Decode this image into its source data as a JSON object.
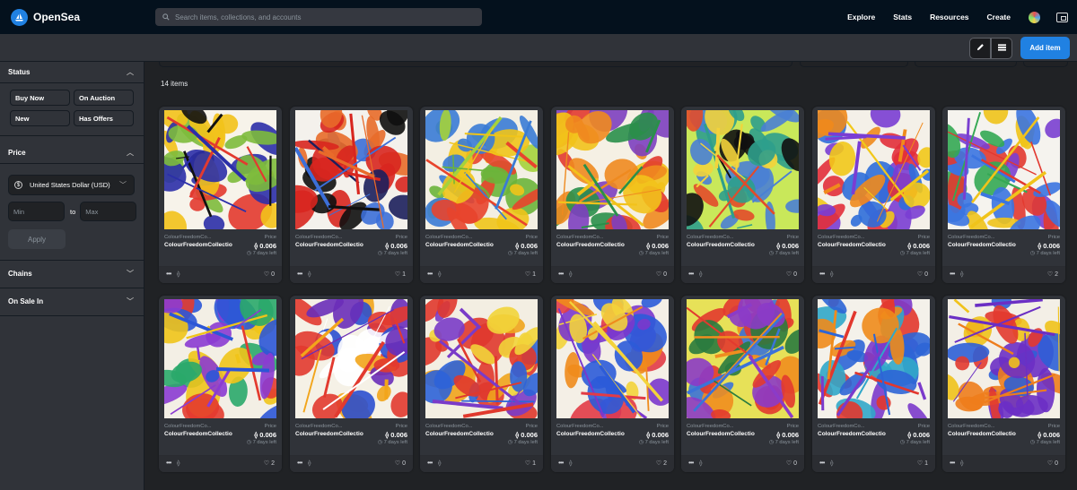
{
  "header": {
    "brand": "OpenSea",
    "search_placeholder": "Search items, collections, and accounts",
    "nav": [
      "Explore",
      "Stats",
      "Resources",
      "Create"
    ]
  },
  "toolbar": {
    "add_item_label": "Add item"
  },
  "sidebar": {
    "status": {
      "title": "Status",
      "chips": [
        "Buy Now",
        "On Auction",
        "New",
        "Has Offers"
      ]
    },
    "price": {
      "title": "Price",
      "currency": "United States Dollar (USD)",
      "min_placeholder": "Min",
      "to_label": "to",
      "max_placeholder": "Max",
      "apply_label": "Apply"
    },
    "chains": {
      "title": "Chains"
    },
    "on_sale_in": {
      "title": "On Sale In"
    }
  },
  "main": {
    "items_count": "14 items"
  },
  "card_common": {
    "collection_short": "ColourFreedomCo...",
    "price_label": "Price",
    "name": "ColourFreedomCollectio",
    "price": "0.006",
    "time_left": "7 days left"
  },
  "cards": [
    {
      "likes": "0",
      "palette": [
        "#f7f3ea",
        "#2b2fa8",
        "#e23a2f",
        "#f2c21b",
        "#7dbb3c",
        "#111111"
      ]
    },
    {
      "likes": "1",
      "palette": [
        "#f4f1ec",
        "#d8261f",
        "#1c1f5c",
        "#101010",
        "#e86b2a",
        "#3c6fd8"
      ]
    },
    {
      "likes": "1",
      "palette": [
        "#f3efe3",
        "#f0c419",
        "#6bb43a",
        "#e8442c",
        "#3a7bd5",
        "#a5d23b"
      ]
    },
    {
      "likes": "0",
      "palette": [
        "#f5f0e4",
        "#ef8a1f",
        "#e23a2f",
        "#f2c21b",
        "#2a8f4a",
        "#7d3fbf"
      ]
    },
    {
      "likes": "0",
      "palette": [
        "#c9e85a",
        "#2e9e8c",
        "#111111",
        "#f3d33b",
        "#e24b2a",
        "#4a7fd4"
      ]
    },
    {
      "likes": "0",
      "palette": [
        "#f4f0e8",
        "#7a3dd3",
        "#f08a1c",
        "#e22f3a",
        "#2f6ed9",
        "#f2c819"
      ]
    },
    {
      "likes": "2",
      "palette": [
        "#f5f3ee",
        "#3b74e0",
        "#f0c31a",
        "#7a3fd0",
        "#e2382f",
        "#34a853"
      ]
    },
    {
      "likes": "2",
      "palette": [
        "#f3efe5",
        "#8b3bd1",
        "#e33b2f",
        "#2c56d6",
        "#f0c419",
        "#2aa86a"
      ]
    },
    {
      "likes": "0",
      "palette": [
        "#f5f1e6",
        "#e23a2f",
        "#2b4fcf",
        "#f2a51b",
        "#6a2db8",
        "#ffffff"
      ]
    },
    {
      "likes": "1",
      "palette": [
        "#f3eee2",
        "#e0392d",
        "#f0a41d",
        "#2e63d8",
        "#7a3bc8",
        "#f2d43a"
      ]
    },
    {
      "likes": "2",
      "palette": [
        "#f4efe6",
        "#7b37cc",
        "#ef8b1c",
        "#2c5bd8",
        "#e23b46",
        "#f3d33b"
      ]
    },
    {
      "likes": "0",
      "palette": [
        "#e7e158",
        "#e23a2f",
        "#2a7b3f",
        "#f08e1f",
        "#3b73d8",
        "#8b3bc8"
      ]
    },
    {
      "likes": "1",
      "palette": [
        "#f4f1ea",
        "#e2372d",
        "#f08b1b",
        "#2d65d6",
        "#31a7c9",
        "#7b3acb"
      ]
    },
    {
      "likes": "0",
      "palette": [
        "#f3efe6",
        "#6b2fc4",
        "#f0c21b",
        "#e23a2f",
        "#2d5fd6",
        "#ee7d1c"
      ]
    }
  ],
  "colors": {
    "accent": "#2081e2",
    "header_bg": "#04111d",
    "panel_bg": "#303339",
    "page_bg": "#202225"
  }
}
